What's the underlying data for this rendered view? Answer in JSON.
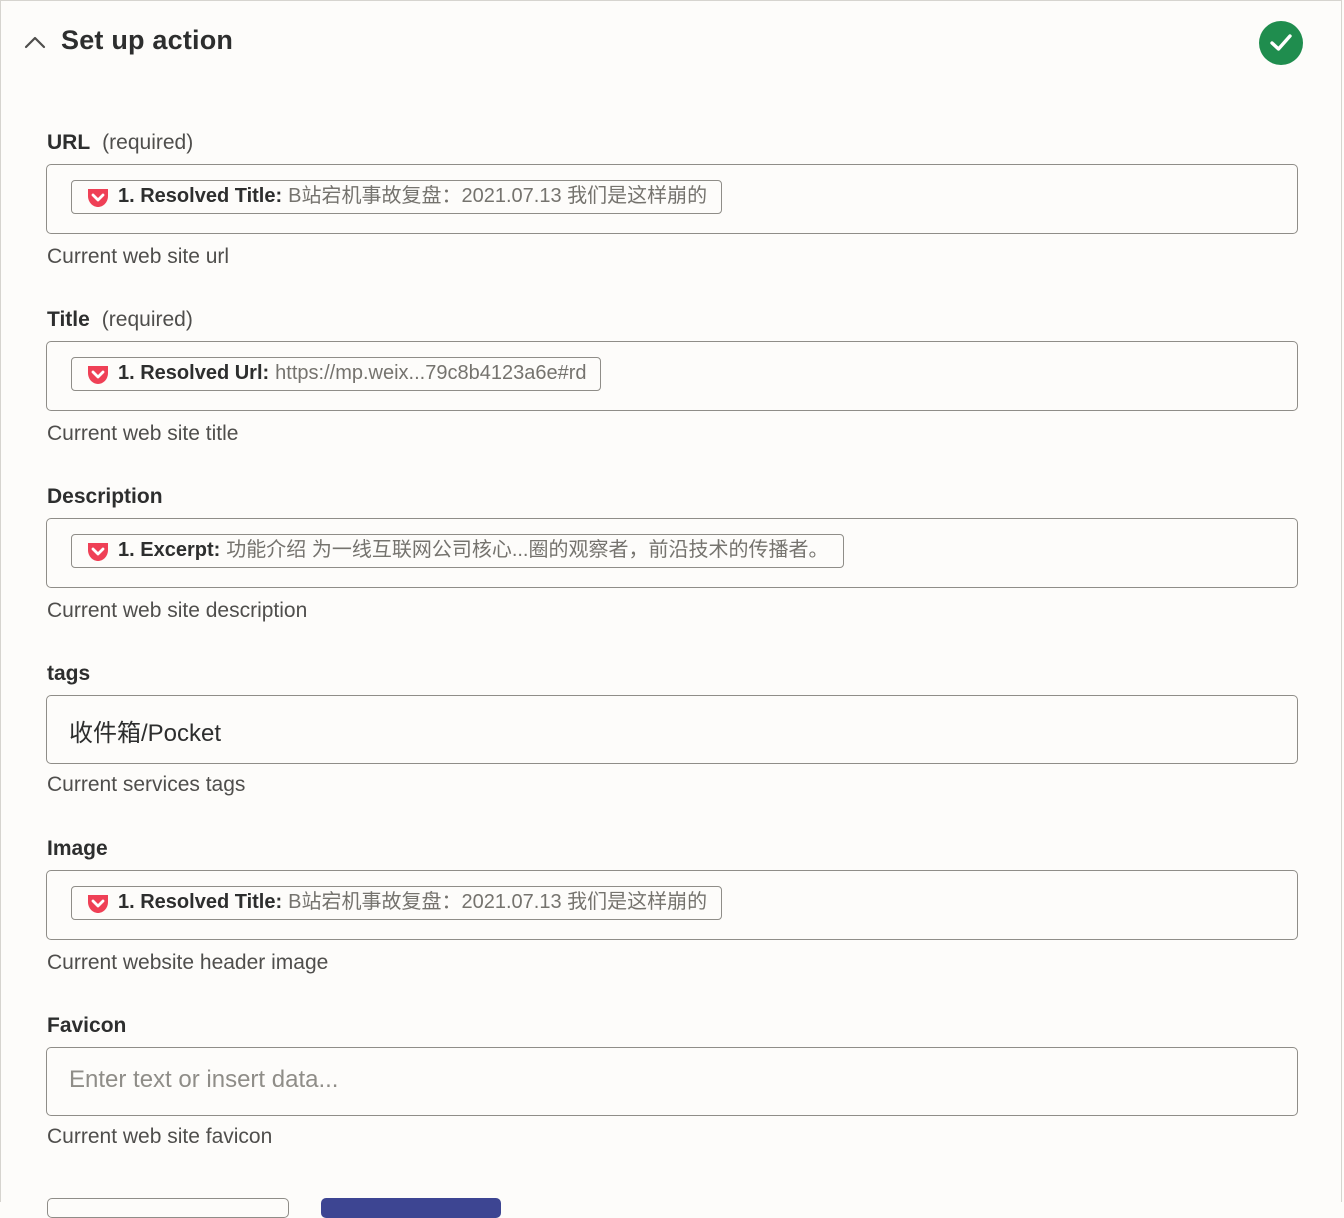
{
  "header": {
    "title": "Set up action"
  },
  "colors": {
    "success": "#1f8d4e",
    "pocket": "#ef4056",
    "primary_button": "#3d4592"
  },
  "fields": [
    {
      "label": "URL",
      "required": "(required)",
      "pill_label": "1. Resolved Title:",
      "pill_value": "B站宕机事故复盘：2021.07.13 我们是这样崩的",
      "help": "Current web site url"
    },
    {
      "label": "Title",
      "required": "(required)",
      "pill_label": "1. Resolved Url:",
      "pill_value": "https://mp.weix...79c8b4123a6e#rd",
      "help": "Current web site title"
    },
    {
      "label": "Description",
      "pill_label": "1. Excerpt:",
      "pill_value": "功能介绍 为一线互联网公司核心...圈的观察者，前沿技术的传播者。",
      "help": "Current web site description"
    },
    {
      "label": "tags",
      "value": "收件箱/Pocket",
      "help": "Current services tags"
    },
    {
      "label": "Image",
      "pill_label": "1. Resolved Title:",
      "pill_value": "B站宕机事故复盘：2021.07.13 我们是这样崩的",
      "help": "Current website header image"
    },
    {
      "label": "Favicon",
      "placeholder": "Enter text or insert data...",
      "help": "Current web site favicon"
    }
  ]
}
